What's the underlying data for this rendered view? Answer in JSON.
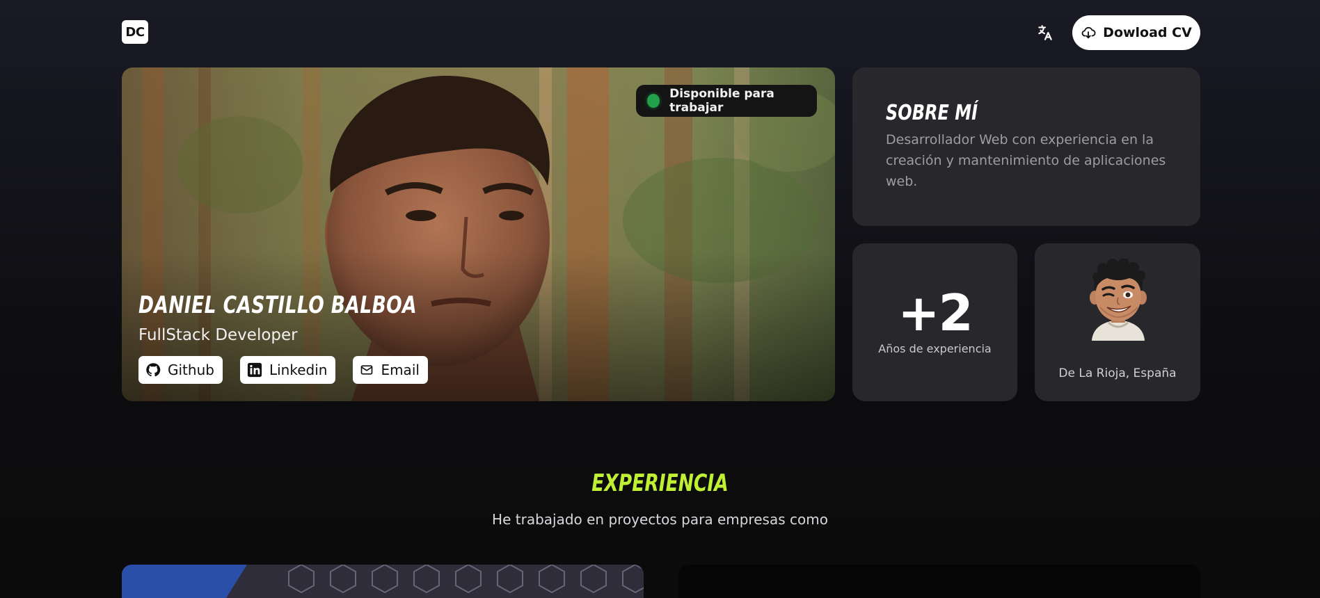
{
  "header": {
    "logo": "DC",
    "translate_icon": "translate-icon",
    "cv_button_label": "Dowload CV",
    "cv_icon": "cloud-download-icon"
  },
  "hero": {
    "status_badge": "Disponible para trabajar",
    "status_color": "#22a04a",
    "name": "Daniel Castillo Balboa",
    "role": "FullStack Developer",
    "links": [
      {
        "label": "Github",
        "icon": "github-icon"
      },
      {
        "label": "Linkedin",
        "icon": "linkedin-icon"
      },
      {
        "label": "Email",
        "icon": "mail-icon"
      }
    ]
  },
  "about": {
    "title": "Sobre mí",
    "text": "Desarrollador Web con experiencia en la creación y mantenimiento de aplicaciones web."
  },
  "experience_card": {
    "value": "+2",
    "label": "Años de experiencia"
  },
  "location_card": {
    "label": "De La Rioja, España"
  },
  "experience": {
    "title": "Experiencia",
    "subtitle": "He trabajado en proyectos para empresas como",
    "accent_color": "#bff034"
  }
}
